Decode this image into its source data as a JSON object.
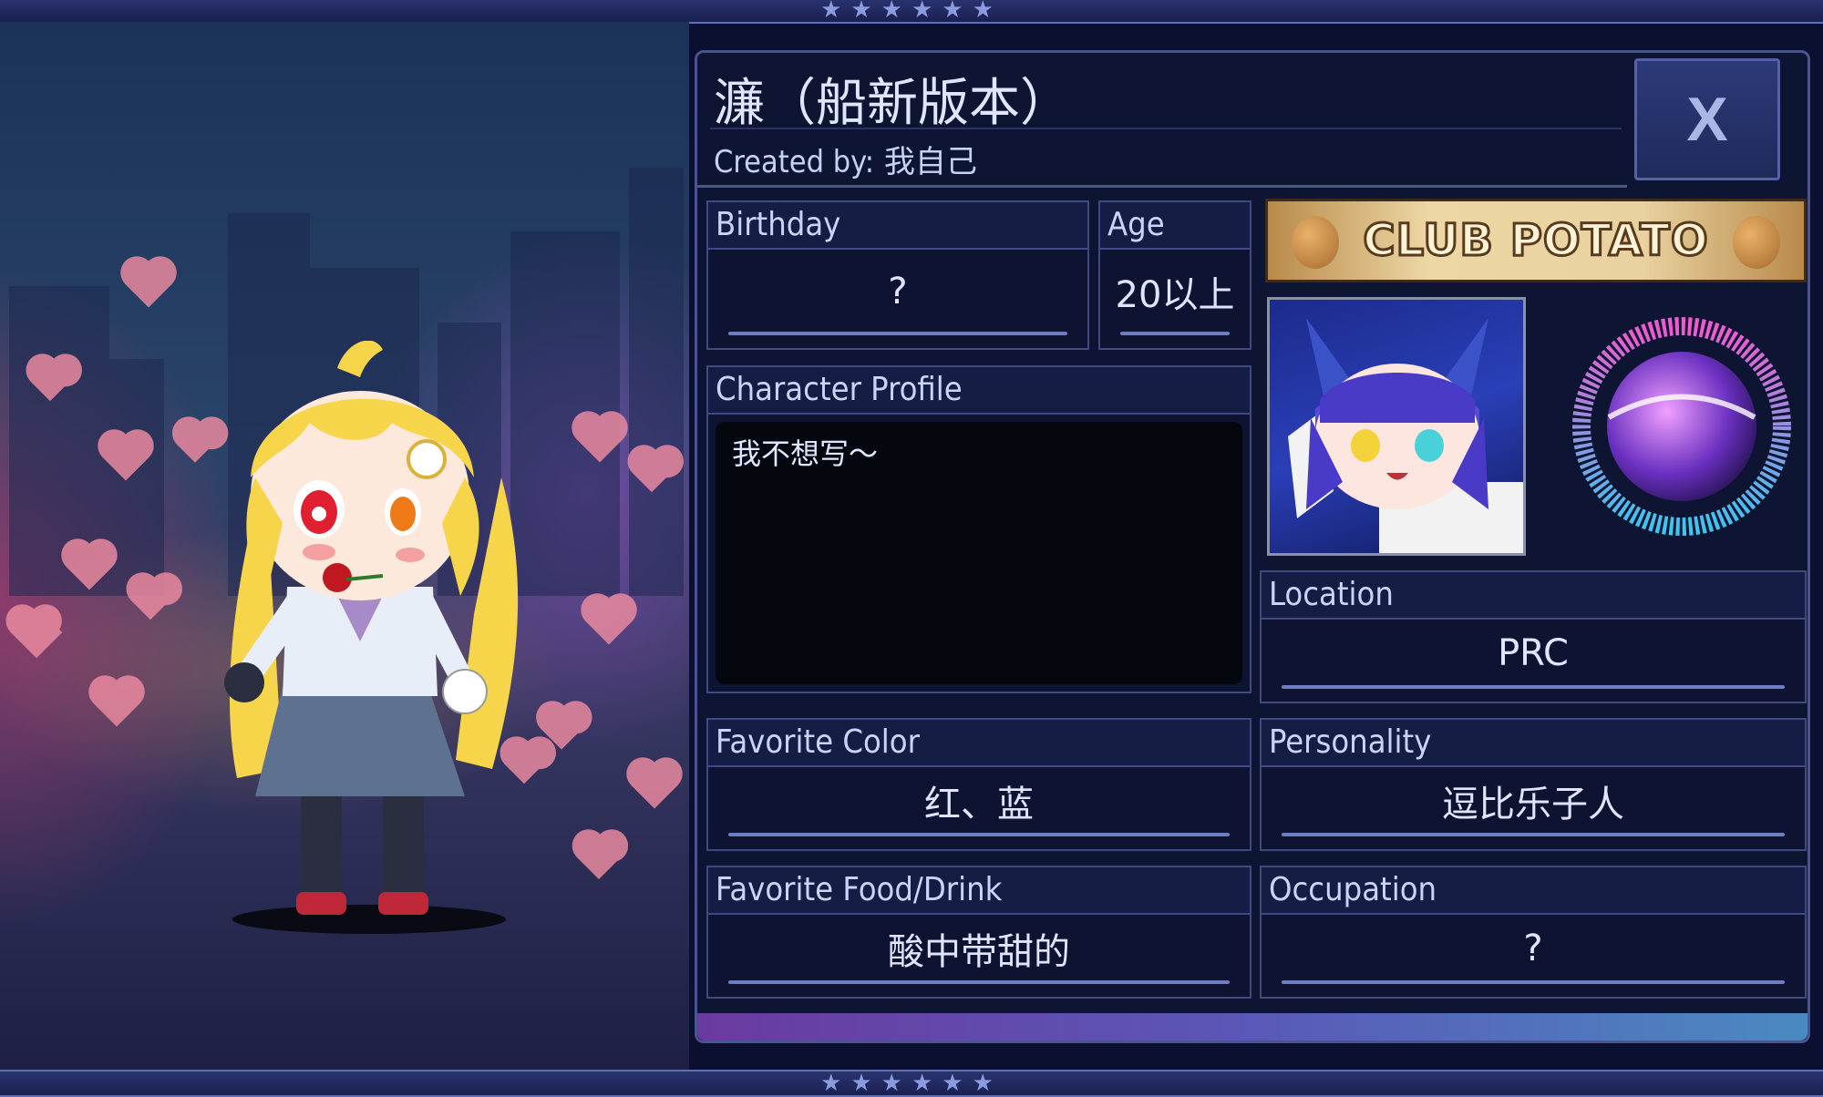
{
  "header": {
    "title": "濂（船新版本）",
    "created_by_label": "Created by:",
    "created_by_value": "我自己",
    "close_label": "X"
  },
  "fields": {
    "birthday": {
      "label": "Birthday",
      "value": "?"
    },
    "age": {
      "label": "Age",
      "value": "20以上"
    },
    "character_profile": {
      "label": "Character Profile",
      "value": "我不想写～"
    },
    "location": {
      "label": "Location",
      "value": "PRC"
    },
    "favorite_color": {
      "label": "Favorite Color",
      "value": "红、蓝"
    },
    "personality": {
      "label": "Personality",
      "value": "逗比乐子人"
    },
    "favorite_food": {
      "label": "Favorite Food/Drink",
      "value": "酸中带甜的"
    },
    "occupation": {
      "label": "Occupation",
      "value": "?"
    }
  },
  "banner": {
    "text": "CLUB POTATO"
  },
  "colors": {
    "panel_bg": "#0e1532",
    "border": "#4a5590",
    "label_text": "#c9d5f6",
    "value_text": "#dfe6ff"
  },
  "icons": {
    "close": "close-icon",
    "emblem": "music-orb-emblem",
    "avatar": "character-avatar"
  }
}
